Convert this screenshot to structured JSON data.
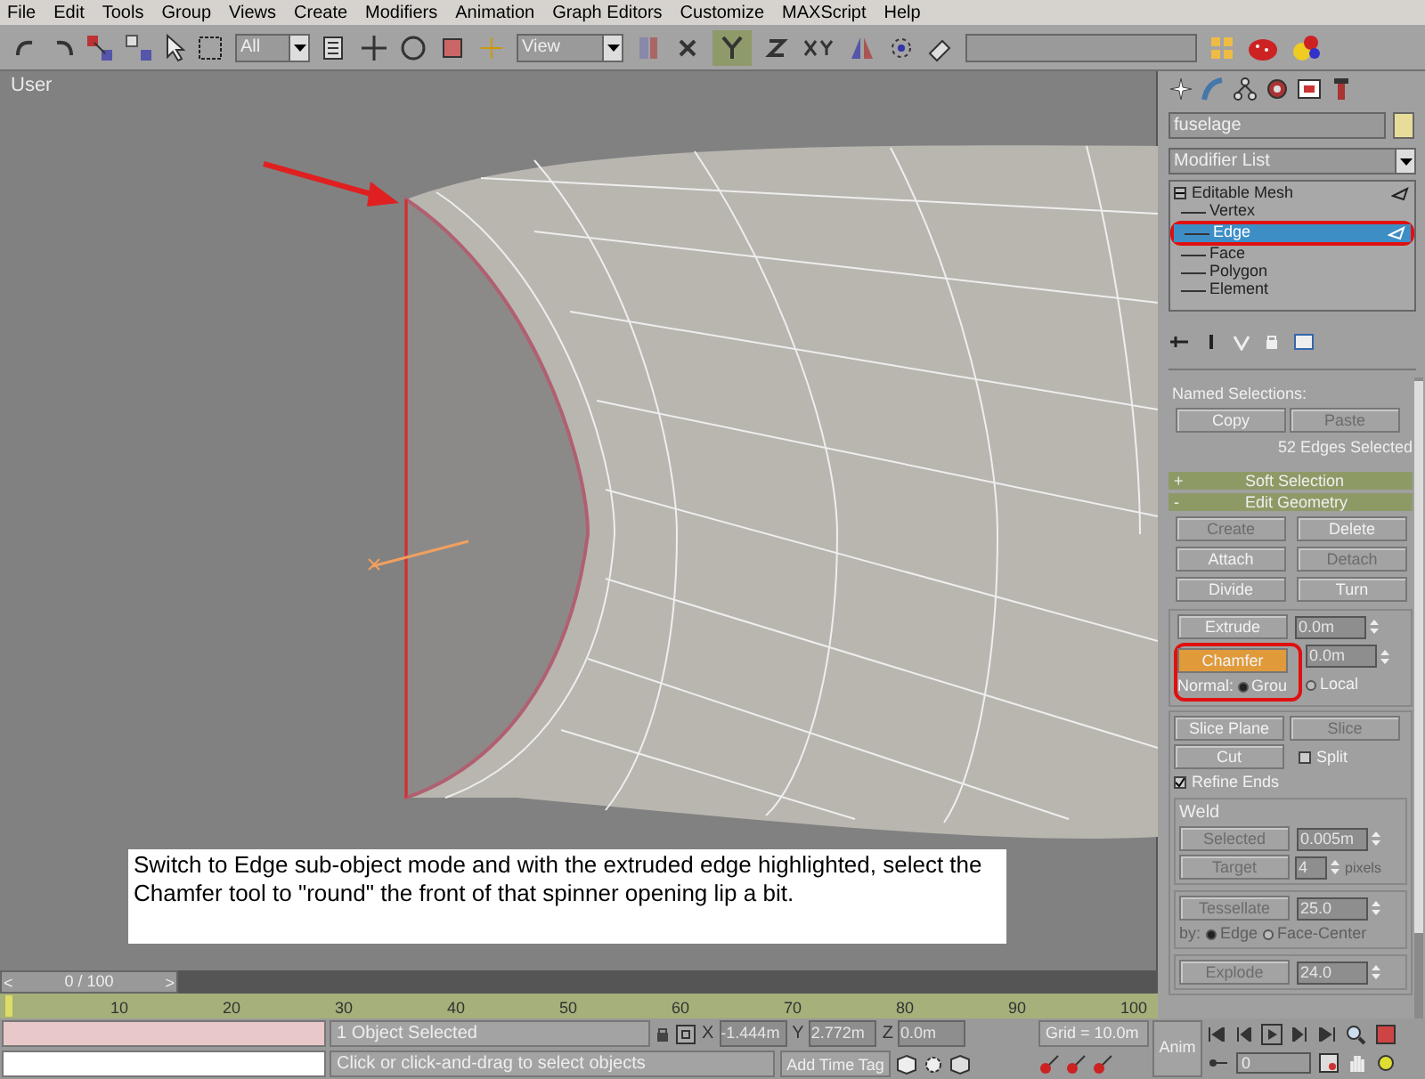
{
  "menu_bar": [
    "File",
    "Edit",
    "Tools",
    "Group",
    "Views",
    "Create",
    "Modifiers",
    "Animation",
    "Graph Editors",
    "Customize",
    "MAXScript",
    "Help"
  ],
  "toolbar": {
    "selection_filter": "All",
    "reference_coordinate": "View"
  },
  "viewport": {
    "label": "User",
    "caption": "Switch to Edge sub-object mode and with the extruded edge highlighted, select the Chamfer tool to \"round\" the front of that spinner opening lip a bit."
  },
  "command_panel": {
    "object_name": "fuselage",
    "modifier_list": "Modifier List",
    "stack": [
      {
        "label": "Editable Mesh",
        "expanded": true,
        "children": [
          {
            "label": "Vertex",
            "selected": false
          },
          {
            "label": "Edge",
            "selected": true
          },
          {
            "label": "Face",
            "selected": false
          },
          {
            "label": "Polygon",
            "selected": false
          },
          {
            "label": "Element",
            "selected": false
          }
        ]
      }
    ],
    "named_selections": {
      "label": "Named Selections:",
      "buttons": [
        {
          "label": "Copy",
          "disabled": false
        },
        {
          "label": "Paste",
          "disabled": true
        }
      ],
      "status": "52 Edges Selected"
    },
    "rollouts": [
      {
        "sign": "+",
        "title": "Soft Selection"
      },
      {
        "sign": "-",
        "title": "Edit Geometry"
      }
    ],
    "geometry_buttons": [
      {
        "label": "Create",
        "disabled": true
      },
      {
        "label": "Delete",
        "disabled": false
      },
      {
        "label": "Attach",
        "disabled": false
      },
      {
        "label": "Detach",
        "disabled": true
      },
      {
        "label": "Divide",
        "disabled": false
      },
      {
        "label": "Turn",
        "disabled": false
      }
    ],
    "extrude": {
      "label": "Extrude",
      "value": "0.0m"
    },
    "chamfer": {
      "label": "Chamfer",
      "value": "0.0m",
      "active": true
    },
    "normal": {
      "label": "Normal:",
      "options": [
        {
          "label": "Grou",
          "selected": true
        },
        {
          "label": "Local",
          "selected": false
        }
      ]
    },
    "slice_buttons": [
      {
        "label": "Slice Plane",
        "disabled": false
      },
      {
        "label": "Slice",
        "disabled": true
      }
    ],
    "cut": {
      "label": "Cut"
    },
    "split": {
      "label": "Split",
      "checked": false
    },
    "refine_ends": {
      "label": "Refine Ends",
      "checked": true
    },
    "weld": {
      "title": "Weld",
      "selected_button": "Selected",
      "selected_value": "0.005m",
      "target_button": "Target",
      "target_value": "4",
      "target_unit": "pixels"
    },
    "tessellate": {
      "button": "Tessellate",
      "value": "25.0",
      "by_label": "by:",
      "options": [
        {
          "label": "Edge",
          "selected": true
        },
        {
          "label": "Face-Center",
          "selected": false
        }
      ]
    },
    "explode": {
      "button": "Explode",
      "value": "24.0"
    }
  },
  "time_slider": {
    "label": "0 / 100",
    "prev": "<",
    "next": ">",
    "level": 0
  },
  "timeline": {
    "ticks": [
      "10",
      "20",
      "30",
      "40",
      "50",
      "60",
      "70",
      "80",
      "90",
      "100"
    ]
  },
  "status_bar": {
    "selection": "1 Object Selected",
    "prompt": "Click or click-and-drag to select objects",
    "coordinates": [
      {
        "axis": "X",
        "value": "-1.444m"
      },
      {
        "axis": "Y",
        "value": "2.772m"
      },
      {
        "axis": "Z",
        "value": "0.0m"
      }
    ],
    "grid": "Grid = 10.0m",
    "add_time_tag": "Add Time Tag",
    "anim": "Anim",
    "frame": "0"
  }
}
